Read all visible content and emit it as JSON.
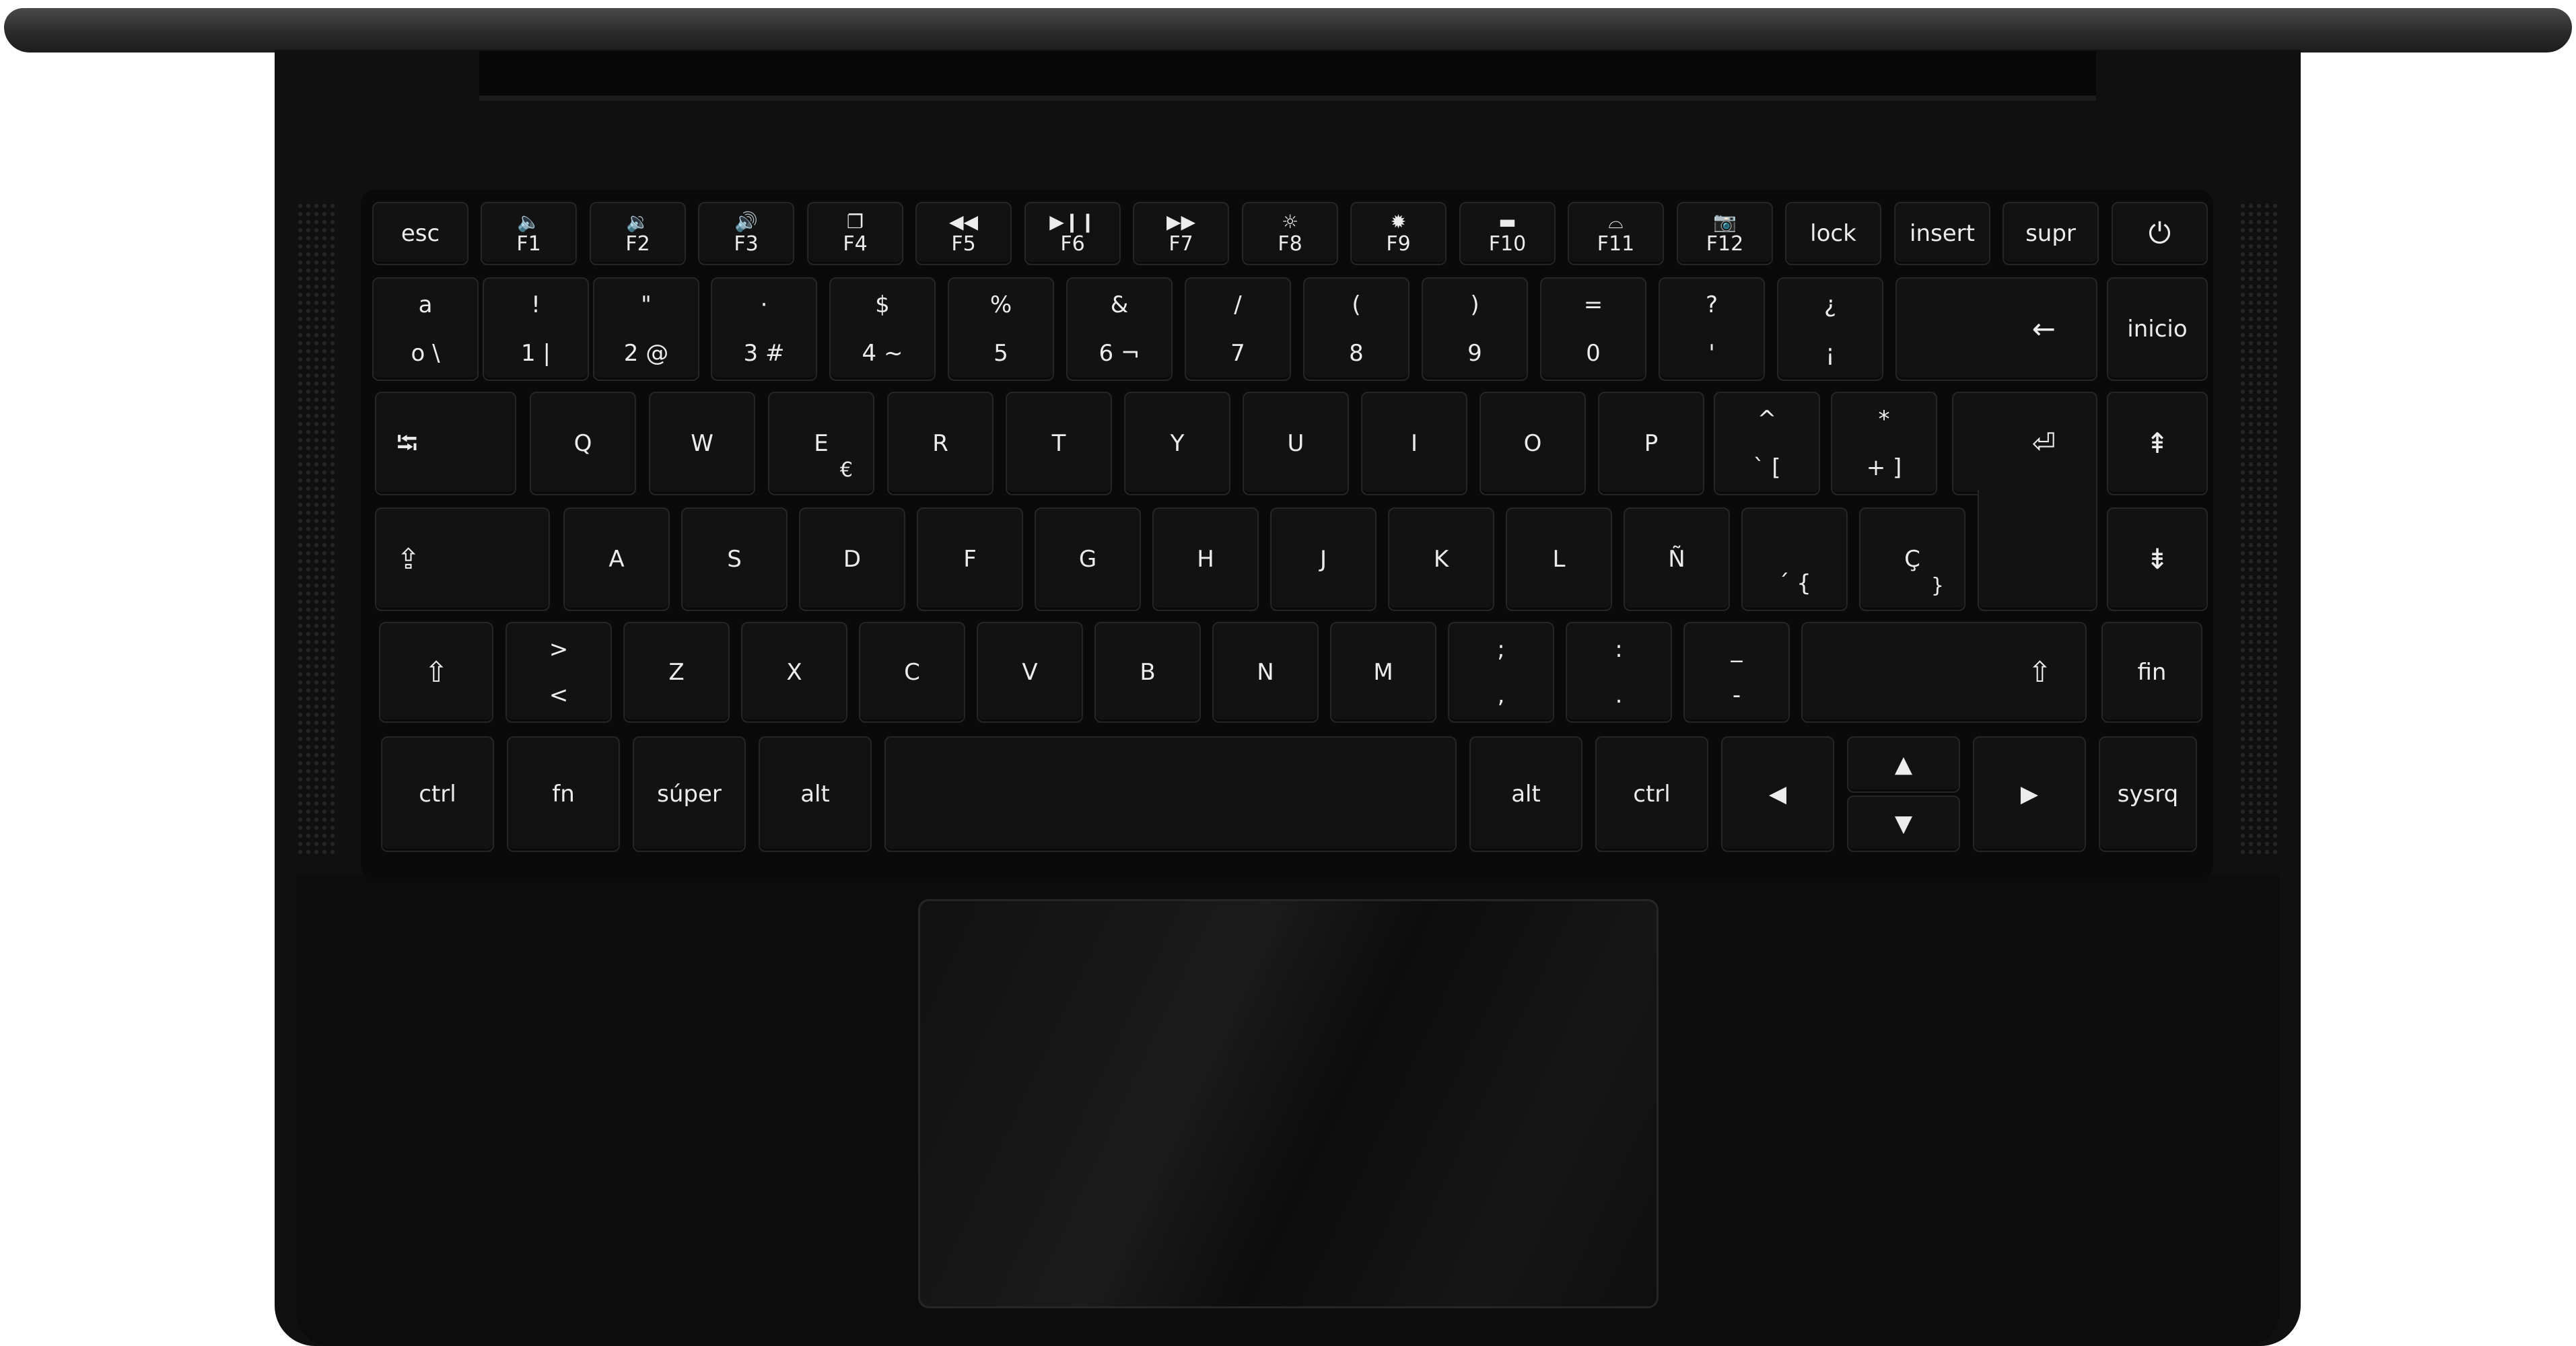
{
  "fn_row": [
    {
      "label": "esc",
      "icon": null
    },
    {
      "label": "F1",
      "icon": "🔈"
    },
    {
      "label": "F2",
      "icon": "🔉"
    },
    {
      "label": "F3",
      "icon": "🔊"
    },
    {
      "label": "F4",
      "icon": "❐"
    },
    {
      "label": "F5",
      "icon": "◀◀"
    },
    {
      "label": "F6",
      "icon": "▶❙❙"
    },
    {
      "label": "F7",
      "icon": "▶▶"
    },
    {
      "label": "F8",
      "icon": "☼"
    },
    {
      "label": "F9",
      "icon": "✹"
    },
    {
      "label": "F10",
      "icon": "▬"
    },
    {
      "label": "F11",
      "icon": "⌓"
    },
    {
      "label": "F12",
      "icon": "📷"
    },
    {
      "label": "lock",
      "icon": null
    },
    {
      "label": "insert",
      "icon": null
    },
    {
      "label": "supr",
      "icon": null
    },
    {
      "label": "",
      "icon": "⏻"
    }
  ],
  "number_row": [
    {
      "top": "a",
      "bottom": "o  \\"
    },
    {
      "top": "!",
      "bottom": "1  |"
    },
    {
      "top": "\"",
      "bottom": "2 @"
    },
    {
      "top": "·",
      "bottom": "3  #"
    },
    {
      "top": "$",
      "bottom": "4  ~"
    },
    {
      "top": "%",
      "bottom": "5"
    },
    {
      "top": "&",
      "bottom": "6  ¬"
    },
    {
      "top": "/",
      "bottom": "7"
    },
    {
      "top": "(",
      "bottom": "8"
    },
    {
      "top": ")",
      "bottom": "9"
    },
    {
      "top": "=",
      "bottom": "0"
    },
    {
      "top": "?",
      "bottom": "'"
    },
    {
      "top": "¿",
      "bottom": "¡"
    }
  ],
  "number_row_extra": {
    "backspace": "←",
    "home": "inicio"
  },
  "qwerty_row": [
    {
      "label": "Q",
      "sub": ""
    },
    {
      "label": "W",
      "sub": ""
    },
    {
      "label": "E",
      "sub": "€"
    },
    {
      "label": "R",
      "sub": ""
    },
    {
      "label": "T",
      "sub": ""
    },
    {
      "label": "Y",
      "sub": ""
    },
    {
      "label": "U",
      "sub": ""
    },
    {
      "label": "I",
      "sub": ""
    },
    {
      "label": "O",
      "sub": ""
    },
    {
      "label": "P",
      "sub": ""
    }
  ],
  "qwerty_extra": {
    "tab": "⭾",
    "bracket1": {
      "top": "^",
      "bottom": "`  ["
    },
    "bracket2": {
      "top": "*",
      "bottom": "+  ]"
    },
    "enter": "⏎",
    "page_up": "⇞"
  },
  "home_row": [
    "A",
    "S",
    "D",
    "F",
    "G",
    "H",
    "J",
    "K",
    "L",
    "Ñ"
  ],
  "home_extra": {
    "caps": "⇪",
    "accent": "´  {",
    "cedilla": {
      "label": "Ç",
      "sub": "}"
    },
    "page_down": "⇟"
  },
  "shift_row": {
    "lshift": "⇧",
    "angle": {
      "top": ">",
      "bottom": "<"
    },
    "letters": [
      "Z",
      "X",
      "C",
      "V",
      "B",
      "N",
      "M"
    ],
    "punct": [
      {
        "top": ";",
        "bottom": ","
      },
      {
        "top": ":",
        "bottom": "."
      },
      {
        "top": "_",
        "bottom": "-"
      }
    ],
    "rshift": "⇧",
    "end": "fin"
  },
  "bottom_row": {
    "ctrl": "ctrl",
    "fn": "fn",
    "super": "súper",
    "alt": "alt",
    "space": "",
    "altgr": "alt",
    "rctrl": "ctrl",
    "left": "◀",
    "up": "▲",
    "down": "▼",
    "right": "▶",
    "sysrq": "sysrq"
  }
}
